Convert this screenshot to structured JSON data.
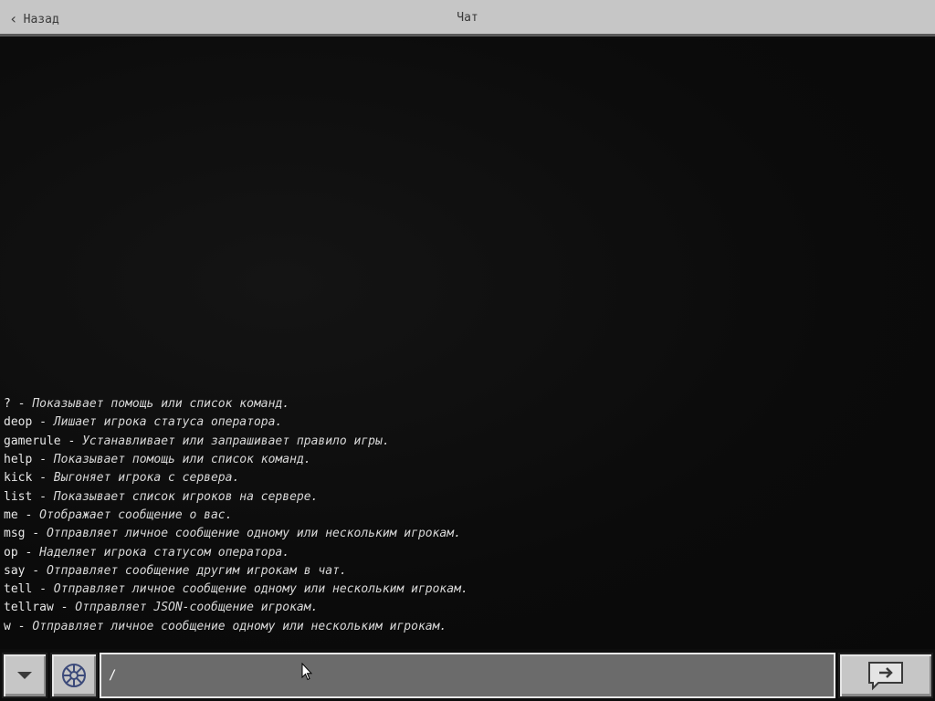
{
  "header": {
    "back_label": "Назад",
    "title": "Чат"
  },
  "messages": [
    {
      "cmd": "?",
      "sep": " - ",
      "desc": "Показывает помощь или список команд."
    },
    {
      "cmd": "deop",
      "sep": " - ",
      "desc": "Лишает игрока статуса оператора."
    },
    {
      "cmd": "gamerule",
      "sep": " - ",
      "desc": "Устанавливает или запрашивает правило игры."
    },
    {
      "cmd": "help",
      "sep": " - ",
      "desc": "Показывает помощь или список команд."
    },
    {
      "cmd": "kick",
      "sep": " - ",
      "desc": "Выгоняет игрока с сервера."
    },
    {
      "cmd": "list",
      "sep": " - ",
      "desc": "Показывает список игроков на сервере."
    },
    {
      "cmd": "me",
      "sep": " - ",
      "desc": "Отображает сообщение о вас."
    },
    {
      "cmd": "msg",
      "sep": " - ",
      "desc": "Отправляет личное сообщение одному или нескольким игрокам."
    },
    {
      "cmd": "op",
      "sep": " - ",
      "desc": "Наделяет игрока статусом оператора."
    },
    {
      "cmd": "say",
      "sep": " - ",
      "desc": "Отправляет сообщение другим игрокам в чат."
    },
    {
      "cmd": "tell",
      "sep": " - ",
      "desc": "Отправляет личное сообщение одному или нескольким игрокам."
    },
    {
      "cmd": "tellraw",
      "sep": " - ",
      "desc": "Отправляет JSON-сообщение игрокам."
    },
    {
      "cmd": "w",
      "sep": " - ",
      "desc": "Отправляет личное сообщение одному или нескольким игрокам."
    }
  ],
  "input": {
    "value": "/"
  },
  "icons": {
    "back": "chevron-left-icon",
    "collapse": "triangle-down-icon",
    "emote": "emote-wheel-icon",
    "send": "send-arrow-icon",
    "pointer": "mouse-pointer-icon"
  },
  "colors": {
    "topbar": "#c6c6c6",
    "button": "#c6c6c6",
    "input_bg": "#6b6b6b",
    "chat_bg": "#0d0d0d",
    "text": "#e8e8e8"
  }
}
